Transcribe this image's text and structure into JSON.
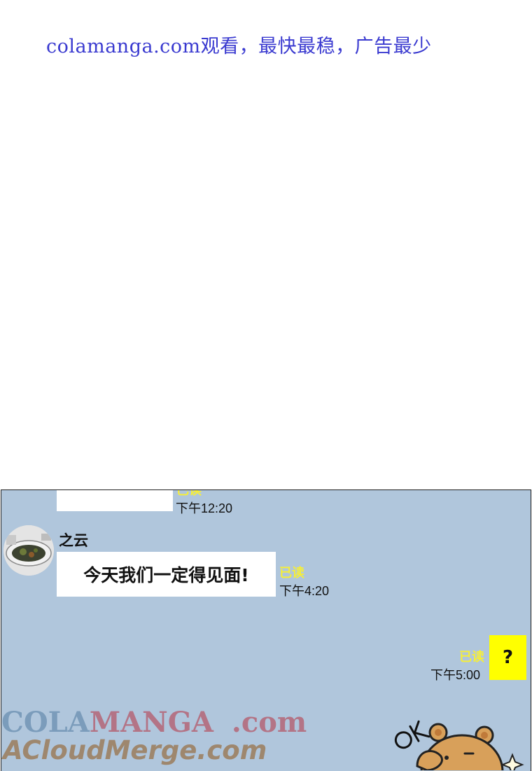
{
  "banner": {
    "text": "colamanga.com观看，最快最稳，广告最少"
  },
  "chat": {
    "previous_message": {
      "read_label": "已读",
      "time": "下午12:20"
    },
    "incoming": {
      "sender": "之云",
      "text": "今天我们一定得见面!",
      "read_label": "已读",
      "time": "下午4:20"
    },
    "outgoing": {
      "text": "?",
      "read_label": "已读",
      "time": "下午5:00"
    },
    "sticker": {
      "caption": "OK",
      "icon": "bear-ok-sticker"
    }
  },
  "watermarks": {
    "line1_a": "COLA",
    "line1_b": "MANGA",
    "line1_c": ".com",
    "line2": "ACloudMerge.com"
  },
  "colors": {
    "chat_background": "#b0c6dc",
    "read_label": "#f5ee3a",
    "outgoing_bubble": "#ffff00",
    "banner_text": "#3a3ad0"
  }
}
